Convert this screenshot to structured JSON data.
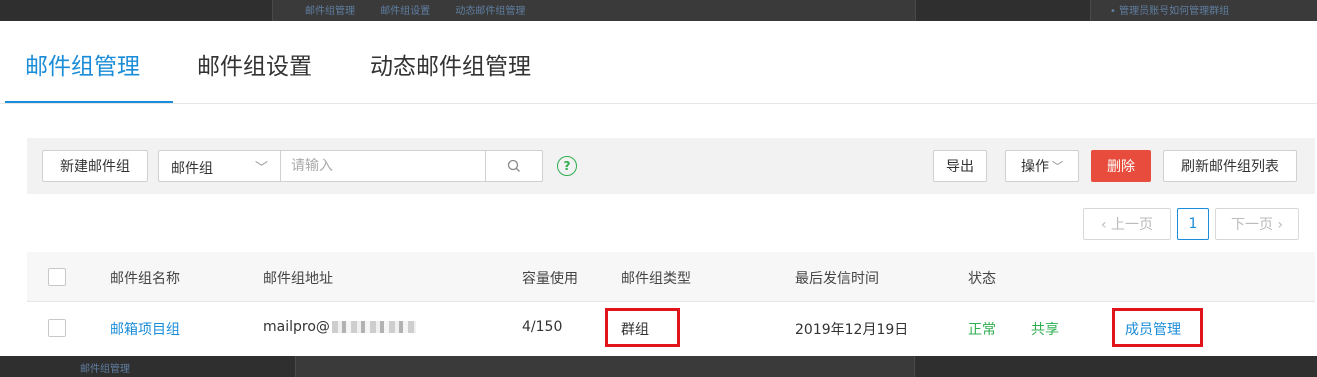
{
  "background": {
    "top_breadcrumbs": [
      "邮件组管理",
      "邮件组设置",
      "动态邮件组管理"
    ],
    "top_help_link": "• 管理员账号如何管理群组",
    "bottom_sidebar_item": "邮件组管理"
  },
  "tabs": [
    {
      "label": "邮件组管理",
      "active": true
    },
    {
      "label": "邮件组设置",
      "active": false
    },
    {
      "label": "动态邮件组管理",
      "active": false
    }
  ],
  "toolbar": {
    "new_group_label": "新建邮件组",
    "filter_select_value": "邮件组",
    "search_placeholder": "请输入",
    "search_icon": "search-icon",
    "help_icon": "?",
    "export_label": "导出",
    "operate_label": "操作",
    "delete_label": "删除",
    "refresh_label": "刷新邮件组列表"
  },
  "pagination": {
    "prev_label": "‹ 上一页",
    "current_page": "1",
    "next_label": "下一页 ›"
  },
  "table": {
    "columns": [
      "邮件组名称",
      "邮件组地址",
      "容量使用",
      "邮件组类型",
      "最后发信时间",
      "状态"
    ],
    "rows": [
      {
        "name": "邮箱项目组",
        "address_prefix": "mailpro@",
        "capacity": "4/150",
        "type": "群组",
        "last_sent": "2019年12月19日",
        "status": "正常",
        "share": "共享",
        "action": "成员管理"
      }
    ]
  },
  "colors": {
    "accent": "#1a8cd8",
    "danger": "#e74c3c",
    "success": "#2fae4f",
    "highlight": "#e1141b"
  }
}
